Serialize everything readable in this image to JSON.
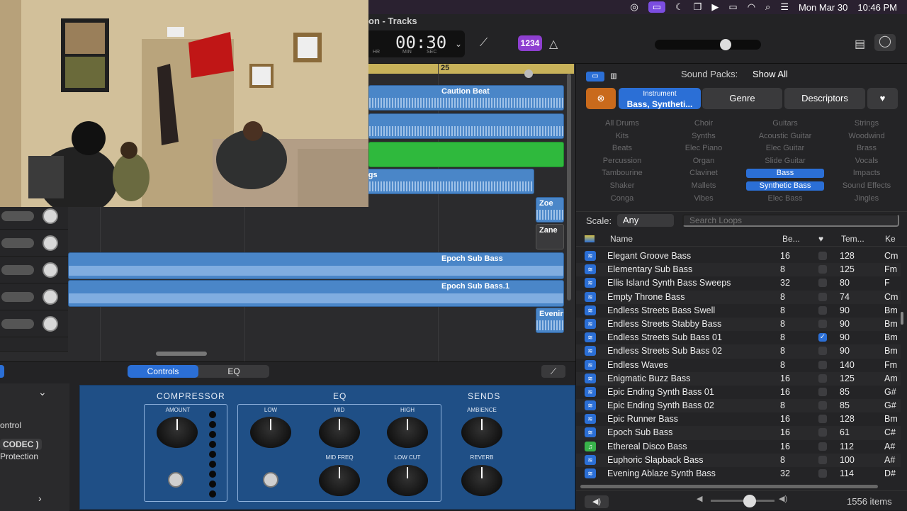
{
  "menubar": {
    "date": "Mon Mar 30",
    "time": "10:46 PM"
  },
  "window": {
    "title": "on - Tracks"
  },
  "lcd": {
    "time": "00:30",
    "hr": "HR",
    "min": "MIN",
    "sec": "SEC"
  },
  "toolbar": {
    "count_in": "1234",
    "master_volume": 0.67
  },
  "ruler": {
    "bar_number": "25"
  },
  "tracks": {
    "regions": [
      {
        "name": "Caution Beat"
      },
      {
        "name": "ngs"
      },
      {
        "name": "Zoe"
      },
      {
        "name": "Zane"
      },
      {
        "name": "Epoch Sub Bass"
      },
      {
        "name": "Epoch Sub Bass.1"
      },
      {
        "name": "Evenin"
      }
    ]
  },
  "smart_controls": {
    "tabs": [
      "Controls",
      "EQ"
    ],
    "left_labels": {
      "control": "ontrol",
      "codec": "CODEC )",
      "protection": "Protection"
    },
    "sections": {
      "compressor": "COMPRESSOR",
      "eq": "EQ",
      "sends": "SENDS"
    },
    "knobs": {
      "amount": "AMOUNT",
      "low": "LOW",
      "mid": "MID",
      "high": "HIGH",
      "mid_freq": "MID FREQ",
      "low_cut": "LOW CUT",
      "ambience": "AMBIENCE",
      "reverb": "REVERB"
    }
  },
  "browser": {
    "packs_label": "Sound Packs:",
    "packs_value": "Show All",
    "filters": {
      "instrument_small": "Instrument",
      "instrument_big": "Bass, Syntheti...",
      "genre": "Genre",
      "descriptors": "Descriptors"
    },
    "keywords": [
      "All Drums",
      "Choir",
      "Guitars",
      "Strings",
      "Kits",
      "Synths",
      "Acoustic Guitar",
      "Woodwind",
      "Beats",
      "Elec Piano",
      "Elec Guitar",
      "Brass",
      "Percussion",
      "Organ",
      "Slide Guitar",
      "Vocals",
      "Tambourine",
      "Clavinet",
      "Bass",
      "Impacts",
      "Shaker",
      "Mallets",
      "Synthetic Bass",
      "Sound Effects",
      "Conga",
      "Vibes",
      "Elec Bass",
      "Jingles"
    ],
    "selected_keywords": [
      "Bass",
      "Synthetic Bass"
    ],
    "scale_label": "Scale:",
    "scale_value": "Any",
    "search_placeholder": "Search Loops",
    "columns": {
      "name": "Name",
      "beats": "Be...",
      "tempo": "Tem...",
      "key": "Ke"
    },
    "rows": [
      {
        "name": "Elegant Groove Bass",
        "beats": "16",
        "fav": false,
        "tempo": "128",
        "key": "Cm"
      },
      {
        "name": "Elementary Sub Bass",
        "beats": "8",
        "fav": false,
        "tempo": "125",
        "key": "Fm"
      },
      {
        "name": "Ellis Island Synth Bass Sweeps",
        "beats": "32",
        "fav": false,
        "tempo": "80",
        "key": "F"
      },
      {
        "name": "Empty Throne Bass",
        "beats": "8",
        "fav": false,
        "tempo": "74",
        "key": "Cm"
      },
      {
        "name": "Endless Streets Bass Swell",
        "beats": "8",
        "fav": false,
        "tempo": "90",
        "key": "Bm"
      },
      {
        "name": "Endless Streets Stabby Bass",
        "beats": "8",
        "fav": false,
        "tempo": "90",
        "key": "Bm"
      },
      {
        "name": "Endless Streets Sub Bass 01",
        "beats": "8",
        "fav": true,
        "tempo": "90",
        "key": "Bm"
      },
      {
        "name": "Endless Streets Sub Bass 02",
        "beats": "8",
        "fav": false,
        "tempo": "90",
        "key": "Bm"
      },
      {
        "name": "Endless Waves",
        "beats": "8",
        "fav": false,
        "tempo": "140",
        "key": "Fm"
      },
      {
        "name": "Enigmatic Buzz Bass",
        "beats": "16",
        "fav": false,
        "tempo": "125",
        "key": "Am"
      },
      {
        "name": "Epic Ending Synth Bass 01",
        "beats": "16",
        "fav": false,
        "tempo": "85",
        "key": "G#"
      },
      {
        "name": "Epic Ending Synth Bass 02",
        "beats": "8",
        "fav": false,
        "tempo": "85",
        "key": "G#"
      },
      {
        "name": "Epic Runner Bass",
        "beats": "16",
        "fav": false,
        "tempo": "128",
        "key": "Bm"
      },
      {
        "name": "Epoch Sub Bass",
        "beats": "16",
        "fav": false,
        "tempo": "61",
        "key": "C#"
      },
      {
        "name": "Ethereal Disco Bass",
        "beats": "16",
        "fav": false,
        "tempo": "112",
        "key": "A#"
      },
      {
        "name": "Euphoric Slapback Bass",
        "beats": "8",
        "fav": false,
        "tempo": "100",
        "key": "A#"
      },
      {
        "name": "Evening Ablaze Synth Bass",
        "beats": "32",
        "fav": false,
        "tempo": "114",
        "key": "D#"
      }
    ],
    "item_count": "1556 items"
  }
}
